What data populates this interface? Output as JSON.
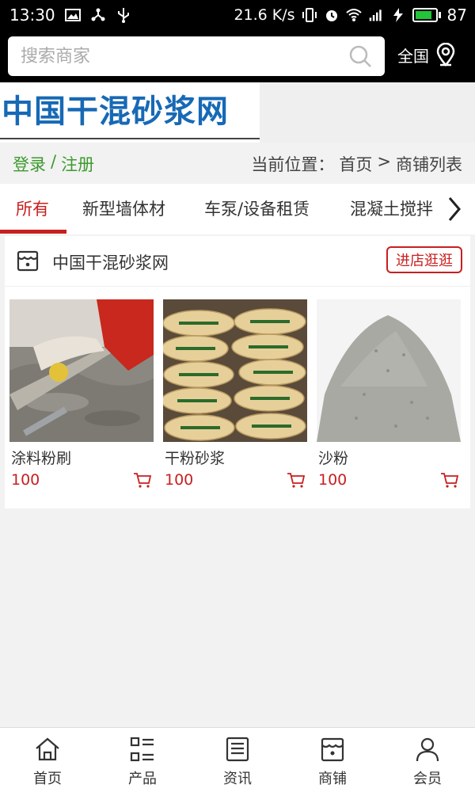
{
  "status_bar": {
    "time": "13:30",
    "speed": "21.6 K/s",
    "battery": "87",
    "battery_fraction": 0.87,
    "icons": [
      "image-icon",
      "share-icon",
      "usb-icon",
      "vibrate-icon",
      "alarm-icon",
      "wifi-icon",
      "signal-4g-icon",
      "charging-icon",
      "battery-icon"
    ]
  },
  "search": {
    "placeholder": "搜索商家",
    "region_label": "全国"
  },
  "logo": {
    "text": "中国干混砂浆网"
  },
  "account": {
    "login": "登录",
    "separator": "/",
    "register": "注册"
  },
  "breadcrumb": {
    "prefix": "当前位置：",
    "home": "首页",
    "arrow": ">",
    "current": "商铺列表"
  },
  "tabs": [
    {
      "label": "所有",
      "active": true
    },
    {
      "label": "新型墙体材",
      "active": false
    },
    {
      "label": "车泵/设备租赁",
      "active": false
    },
    {
      "label": "混凝土搅拌站",
      "active": false
    }
  ],
  "shop": {
    "name": "中国干混砂浆网",
    "visit_label": "进店逛逛",
    "products": [
      {
        "name": "涂料粉刷",
        "price": "100",
        "image": "plastering-photo"
      },
      {
        "name": "干粉砂浆",
        "price": "100",
        "image": "mortar-bags-photo"
      },
      {
        "name": "沙粉",
        "price": "100",
        "image": "sand-pile-photo"
      }
    ]
  },
  "bottom_nav": [
    {
      "label": "首页",
      "icon": "home-icon"
    },
    {
      "label": "产品",
      "icon": "grid-list-icon"
    },
    {
      "label": "资讯",
      "icon": "news-icon"
    },
    {
      "label": "商铺",
      "icon": "store-icon"
    },
    {
      "label": "会员",
      "icon": "user-icon"
    }
  ],
  "colors": {
    "accent": "#c81f1f",
    "login_green": "#3c9a2e",
    "logo_blue": "#1769b5",
    "battery_green": "#22c43a"
  }
}
